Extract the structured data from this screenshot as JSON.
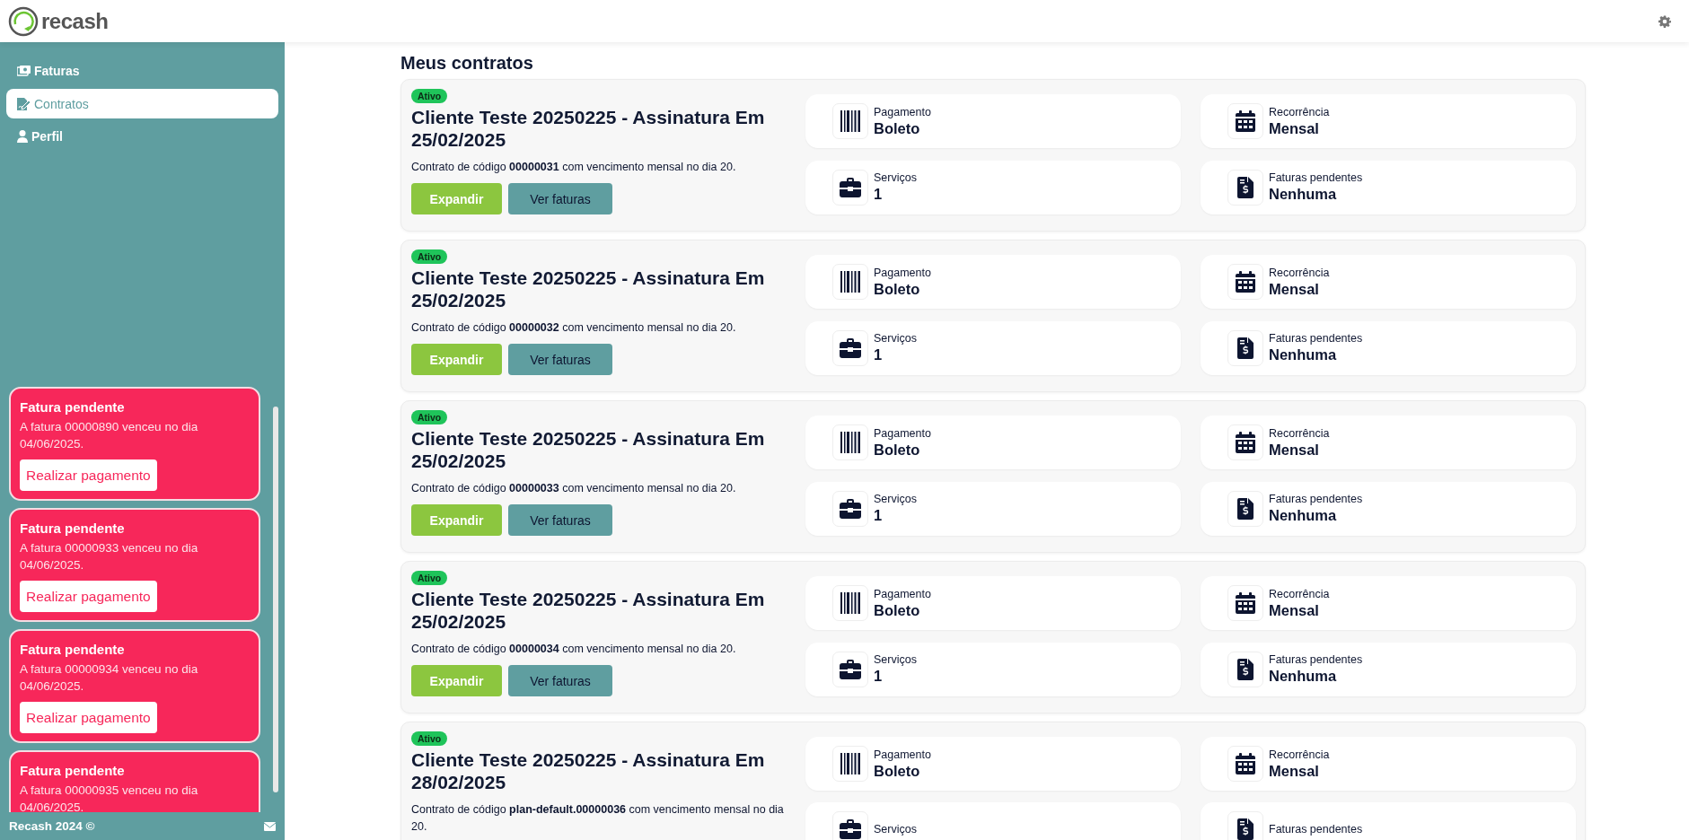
{
  "header": {
    "logo": "recash"
  },
  "sidebar": {
    "items": [
      {
        "label": "Faturas",
        "kind": "invoices",
        "selected": false
      },
      {
        "label": "Contratos",
        "kind": "contracts",
        "selected": true
      },
      {
        "label": "Perfil",
        "kind": "profile",
        "selected": false
      }
    ],
    "notifications": [
      {
        "title": "Fatura pendente",
        "message": "A fatura 00000890 venceu no dia 04/06/2025.",
        "button": "Realizar pagamento"
      },
      {
        "title": "Fatura pendente",
        "message": "A fatura 00000933 venceu no dia 04/06/2025.",
        "button": "Realizar pagamento"
      },
      {
        "title": "Fatura pendente",
        "message": "A fatura 00000934 venceu no dia 04/06/2025.",
        "button": "Realizar pagamento"
      },
      {
        "title": "Fatura pendente",
        "message": "A fatura 00000935 venceu no dia 04/06/2025."
      }
    ],
    "footer": "Recash 2024 ©"
  },
  "main": {
    "title": "Meus contratos",
    "contracts": [
      {
        "status": "Ativo",
        "title": "Cliente Teste 20250225 - Assinatura Em 25/02/2025",
        "description": "Contrato de código **00000031** com vencimento mensal no dia 20.",
        "buttons": [
          {
            "label": "Expandir",
            "kind": "primary"
          },
          {
            "label": "Ver faturas",
            "kind": "secondary"
          }
        ],
        "info": [
          {
            "kind": "payment",
            "label": "Pagamento",
            "value": "Boleto"
          },
          {
            "kind": "recurrence",
            "label": "Recorrência",
            "value": "Mensal"
          },
          {
            "kind": "services",
            "label": "Serviços",
            "value": "1"
          },
          {
            "kind": "pending",
            "label": "Faturas pendentes",
            "value": "Nenhuma"
          }
        ]
      },
      {
        "status": "Ativo",
        "title": "Cliente Teste 20250225 - Assinatura Em 25/02/2025",
        "description": "Contrato de código **00000032** com vencimento mensal no dia 20.",
        "buttons": [
          {
            "label": "Expandir",
            "kind": "primary"
          },
          {
            "label": "Ver faturas",
            "kind": "secondary"
          }
        ],
        "info": [
          {
            "kind": "payment",
            "label": "Pagamento",
            "value": "Boleto"
          },
          {
            "kind": "recurrence",
            "label": "Recorrência",
            "value": "Mensal"
          },
          {
            "kind": "services",
            "label": "Serviços",
            "value": "1"
          },
          {
            "kind": "pending",
            "label": "Faturas pendentes",
            "value": "Nenhuma"
          }
        ]
      },
      {
        "status": "Ativo",
        "title": "Cliente Teste 20250225 - Assinatura Em 25/02/2025",
        "description": "Contrato de código **00000033** com vencimento mensal no dia 20.",
        "buttons": [
          {
            "label": "Expandir",
            "kind": "primary"
          },
          {
            "label": "Ver faturas",
            "kind": "secondary"
          }
        ],
        "info": [
          {
            "kind": "payment",
            "label": "Pagamento",
            "value": "Boleto"
          },
          {
            "kind": "recurrence",
            "label": "Recorrência",
            "value": "Mensal"
          },
          {
            "kind": "services",
            "label": "Serviços",
            "value": "1"
          },
          {
            "kind": "pending",
            "label": "Faturas pendentes",
            "value": "Nenhuma"
          }
        ]
      },
      {
        "status": "Ativo",
        "title": "Cliente Teste 20250225 - Assinatura Em 25/02/2025",
        "description": "Contrato de código **00000034** com vencimento mensal no dia 20.",
        "buttons": [
          {
            "label": "Expandir",
            "kind": "primary"
          },
          {
            "label": "Ver faturas",
            "kind": "secondary"
          }
        ],
        "info": [
          {
            "kind": "payment",
            "label": "Pagamento",
            "value": "Boleto"
          },
          {
            "kind": "recurrence",
            "label": "Recorrência",
            "value": "Mensal"
          },
          {
            "kind": "services",
            "label": "Serviços",
            "value": "1"
          },
          {
            "kind": "pending",
            "label": "Faturas pendentes",
            "value": "Nenhuma"
          }
        ]
      },
      {
        "status": "Ativo",
        "title": "Cliente Teste 20250225 - Assinatura Em 28/02/2025",
        "description": "Contrato de código **plan-default.00000036** com vencimento mensal no dia 20.",
        "info": [
          {
            "kind": "payment",
            "label": "Pagamento",
            "value": "Boleto"
          },
          {
            "kind": "recurrence",
            "label": "Recorrência",
            "value": "Mensal"
          },
          {
            "kind": "services",
            "label": "Serviços"
          },
          {
            "kind": "pending",
            "label": "Faturas pendentes"
          }
        ]
      }
    ]
  }
}
